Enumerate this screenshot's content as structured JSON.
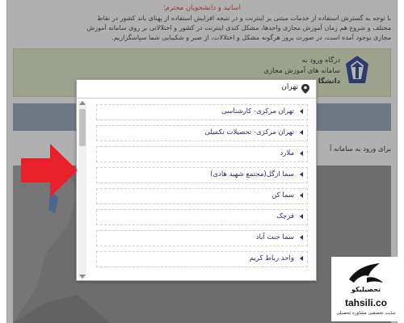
{
  "notice": {
    "title": "اساتید و دانشجویان محترم؛",
    "lines": [
      "با توجه به گسترش استفاده از خدمات مبتنی بر اینترنت و در نتیجه افزایش استفاده از پهنای باند کشور در نقاط",
      "مختلف و شروع هم زمان آموزش مجازی واحدها، مشکل کندی اینترنت در کشور و اختلالاتی بر روی سامانه آموزش",
      "مجازی بوجود آمده است، در صورت بروز هرگونه مشکل و اختلالات، از صبر و شکیبایی شما سپاسگزاریم."
    ]
  },
  "portal": {
    "line1": "درگاه ورود به",
    "line2": "سامانه های آموزش مجازی",
    "line3": "دانشگا"
  },
  "login_text": "برای ورود به سامانه آ",
  "dropdown": {
    "header": "تهران",
    "items": [
      "تهران مرکزی- کارشناسی",
      "تهران مرکزی- تحصیلات تکمیلی",
      "ملارد",
      "سما ازگل(مجتمع شهید هادی)",
      "سما کن",
      "قرچک",
      "سما جنت آباد",
      "واحد رباط کریم"
    ]
  },
  "badge": {
    "brand": "تحصیلیکو",
    "domain": "tahsili.co",
    "tagline": "سایت تخصصی مشاوره تحصیلی"
  },
  "colors": {
    "green_panel": "#d9e1bf",
    "strip": "#7c93a8",
    "item_text": "#2c2c6c",
    "notice_title": "#c0392b",
    "arrow": "#e8202a"
  }
}
